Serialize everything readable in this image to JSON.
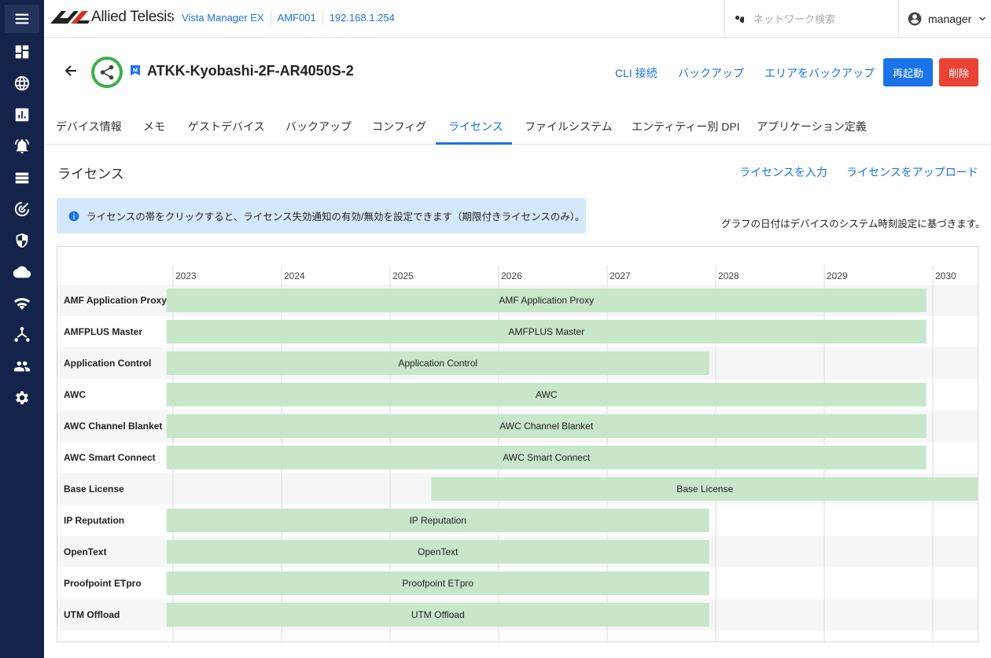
{
  "app": {
    "brand": "Allied Telesis",
    "breadcrumbs": [
      "Vista Manager EX",
      "AMF001",
      "192.168.1.254"
    ],
    "search_placeholder": "ネットワーク検索",
    "user": "manager"
  },
  "sidebar": {
    "items": [
      "menu-icon",
      "dashboard-icon",
      "globe-icon",
      "chart-icon",
      "alarm-bell-icon",
      "list-icon",
      "radar-icon",
      "shield-icon",
      "cloud-icon",
      "wifi-icon",
      "network-topology-icon",
      "users-icon",
      "gear-icon"
    ]
  },
  "device": {
    "name": "ATKK-Kyobashi-2F-AR4050S-2",
    "badge": "M",
    "actions": {
      "cli": "CLI 接続",
      "backup": "バックアップ",
      "area_backup": "エリアをバックアップ",
      "reboot": "再起動",
      "delete": "削除"
    }
  },
  "tabs": [
    {
      "label": "デバイス情報",
      "active": false
    },
    {
      "label": "メモ",
      "active": false
    },
    {
      "label": "ゲストデバイス",
      "active": false
    },
    {
      "label": "バックアップ",
      "active": false
    },
    {
      "label": "コンフィグ",
      "active": false
    },
    {
      "label": "ライセンス",
      "active": true
    },
    {
      "label": "ファイルシステム",
      "active": false
    },
    {
      "label": "エンティティー別 DPI",
      "active": false
    },
    {
      "label": "アプリケーション定義",
      "active": false
    }
  ],
  "section": {
    "title": "ライセンス",
    "enter_license": "ライセンスを入力",
    "upload_license": "ライセンスをアップロード",
    "info": "ライセンスの帯をクリックすると、ライセンス失効通知の有効/無効を設定できます（期限付きライセンスのみ）。",
    "note": "グラフの日付はデバイスのシステム時刻設定に基づきます。"
  },
  "colors": {
    "sidebar": "#14234a",
    "accent": "#1a73e8",
    "danger": "#ea4335",
    "bar": "#c8e6c9",
    "device_ring": "#3dae4a"
  },
  "chart_data": {
    "type": "table",
    "x_axis": {
      "ticks": [
        "2023",
        "2024",
        "2025",
        "2026",
        "2027",
        "2028",
        "2029",
        "2030"
      ]
    },
    "rows": [
      {
        "name": "AMF Application Proxy",
        "start": 2022.94,
        "end": 2029.94
      },
      {
        "name": "AMFPLUS Master",
        "start": 2022.94,
        "end": 2029.94
      },
      {
        "name": "Application Control",
        "start": 2022.94,
        "end": 2027.94
      },
      {
        "name": "AWC",
        "start": 2022.94,
        "end": 2029.94
      },
      {
        "name": "AWC Channel Blanket",
        "start": 2022.94,
        "end": 2029.94
      },
      {
        "name": "AWC Smart Connect",
        "start": 2022.94,
        "end": 2029.94
      },
      {
        "name": "Base License",
        "start": 2025.38,
        "end": 2030.5
      },
      {
        "name": "IP Reputation",
        "start": 2022.94,
        "end": 2027.94
      },
      {
        "name": "OpenText",
        "start": 2022.94,
        "end": 2027.94
      },
      {
        "name": "Proofpoint ETpro",
        "start": 2022.94,
        "end": 2027.94
      },
      {
        "name": "UTM Offload",
        "start": 2022.94,
        "end": 2027.94
      }
    ]
  }
}
